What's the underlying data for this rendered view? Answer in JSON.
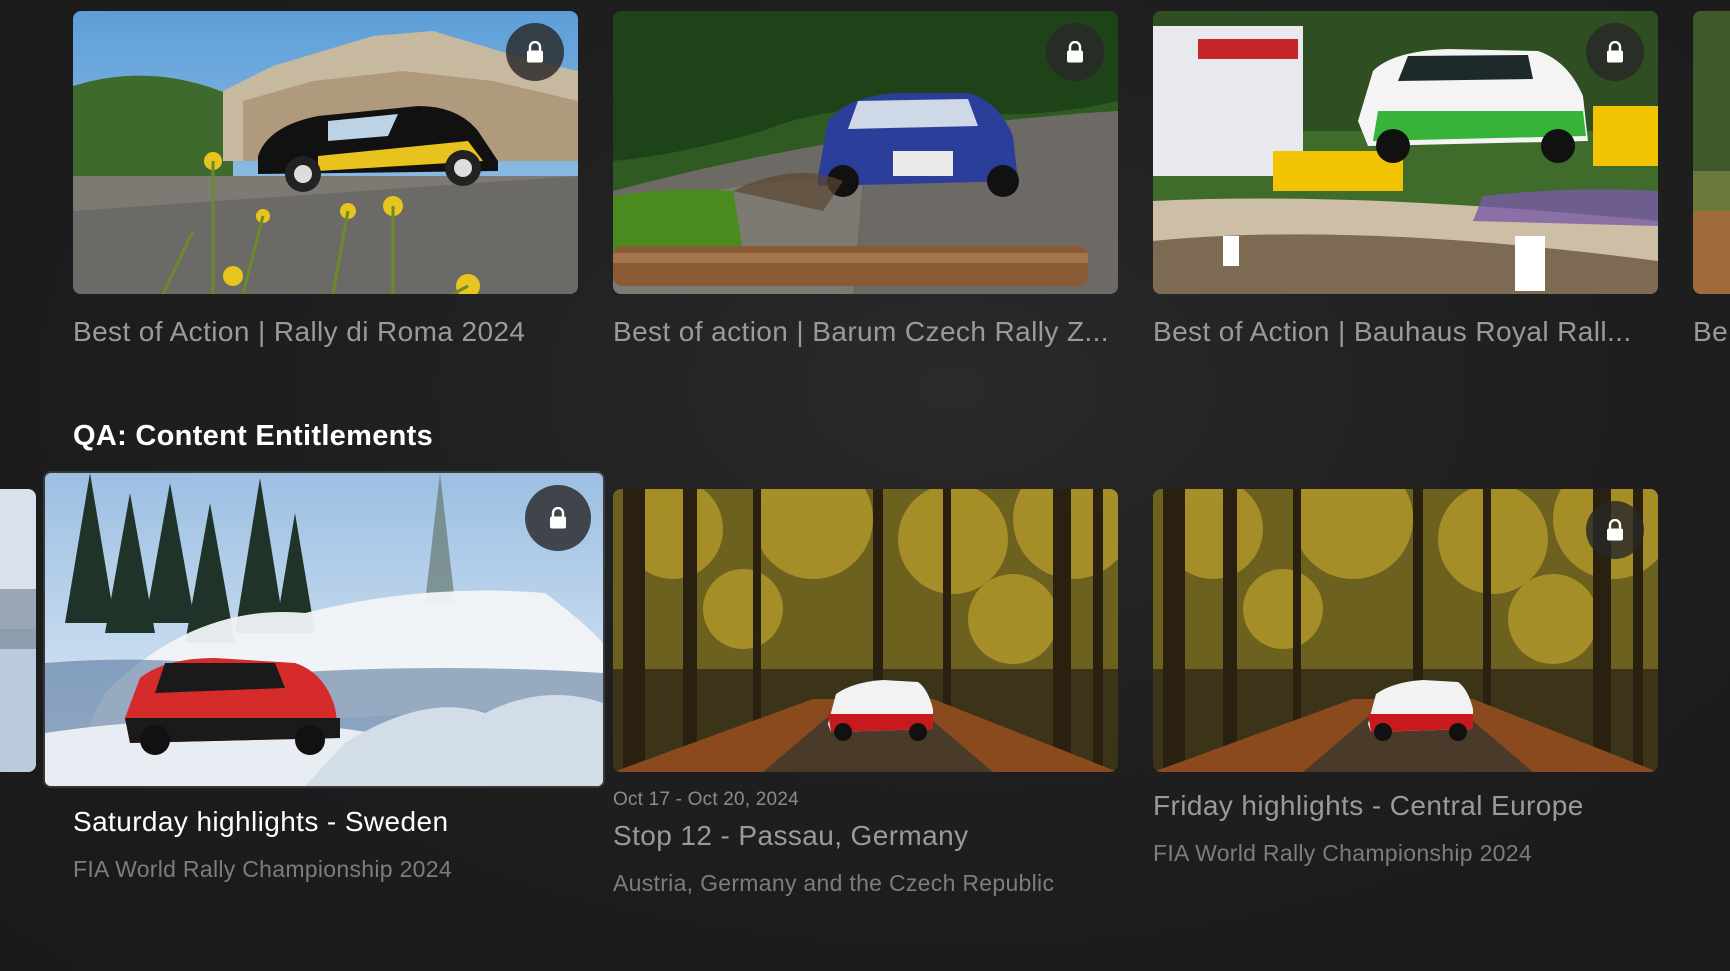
{
  "top_row": {
    "cards": [
      {
        "title": "Best of Action | Rally di Roma 2024",
        "locked": true,
        "thumb_icon": "rally-car-hilltown-thumbnail"
      },
      {
        "title": "Best of action | Barum Czech Rally Z...",
        "locked": true,
        "thumb_icon": "rally-car-forest-road-thumbnail"
      },
      {
        "title": "Best of Action | Bauhaus Royal Rall...",
        "locked": true,
        "thumb_icon": "rally-car-jump-thumbnail"
      },
      {
        "title": "Be",
        "locked": false,
        "thumb_icon": "partial-thumbnail"
      }
    ]
  },
  "section": {
    "title": "QA: Content Entitlements"
  },
  "bottom_row": {
    "cards": [
      {
        "title": "Saturday highlights - Sweden",
        "subtitle": "FIA World Rally Championship 2024",
        "locked": true,
        "focused": true,
        "thumb_icon": "snow-rally-thumbnail"
      },
      {
        "date": "Oct 17 - Oct 20, 2024",
        "title": "Stop 12 - Passau, Germany",
        "subtitle": "Austria, Germany and the Czech Republic",
        "locked": false,
        "thumb_icon": "autumn-forest-rally-thumbnail"
      },
      {
        "title": "Friday highlights - Central Europe",
        "subtitle": "FIA World Rally Championship 2024",
        "locked": true,
        "thumb_icon": "autumn-forest-rally-thumbnail"
      }
    ]
  },
  "colors": {
    "background": "#1c1c1d",
    "title_focused": "#ffffff",
    "title_default": "#9a9a9a",
    "subtitle": "#7d7d7d",
    "lock_badge": "#282828"
  }
}
